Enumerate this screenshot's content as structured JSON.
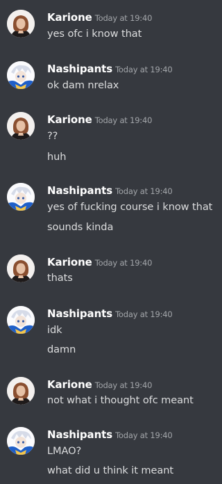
{
  "colors": {
    "background": "#36393f",
    "username": "#ffffff",
    "timestamp": "#a3a6aa",
    "text": "#dcddde"
  },
  "messages": [
    {
      "author": "Karione",
      "avatar": "karione-avatar-icon",
      "time": "Today at 19:40",
      "lines": [
        "yes ofc i know that"
      ]
    },
    {
      "author": "Nashipants",
      "avatar": "nashipants-avatar-icon",
      "time": "Today at 19:40",
      "lines": [
        "ok dam nrelax"
      ]
    },
    {
      "author": "Karione",
      "avatar": "karione-avatar-icon",
      "time": "Today at 19:40",
      "lines": [
        "??",
        "huh"
      ]
    },
    {
      "author": "Nashipants",
      "avatar": "nashipants-avatar-icon",
      "time": "Today at 19:40",
      "lines": [
        "yes of fucking course i know that",
        "sounds kinda"
      ]
    },
    {
      "author": "Karione",
      "avatar": "karione-avatar-icon",
      "time": "Today at 19:40",
      "lines": [
        "thats"
      ]
    },
    {
      "author": "Nashipants",
      "avatar": "nashipants-avatar-icon",
      "time": "Today at 19:40",
      "lines": [
        "idk",
        "damn"
      ]
    },
    {
      "author": "Karione",
      "avatar": "karione-avatar-icon",
      "time": "Today at 19:40",
      "lines": [
        "not what i thought ofc meant"
      ]
    },
    {
      "author": "Nashipants",
      "avatar": "nashipants-avatar-icon",
      "time": "Today at 19:40",
      "lines": [
        "LMAO?",
        "what did u think it meant"
      ]
    }
  ]
}
